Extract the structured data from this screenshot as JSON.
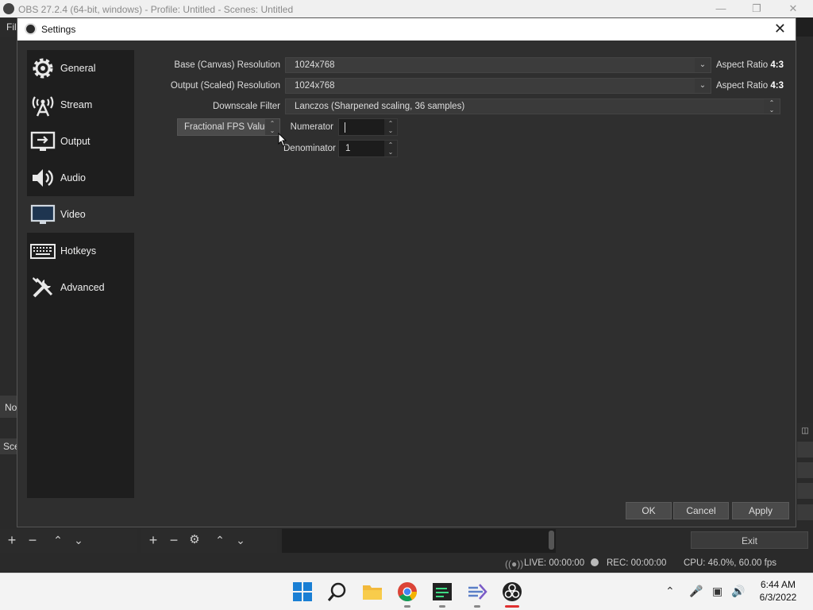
{
  "obs": {
    "title": "OBS 27.2.4 (64-bit, windows) - Profile: Untitled - Scenes: Untitled",
    "menu_partial": "Fil",
    "side_no": "No",
    "side_sce": "Sce",
    "exit_label": "Exit",
    "status": {
      "live": "LIVE: 00:00:00",
      "rec": "REC: 00:00:00",
      "cpu": "CPU: 46.0%, 60.00 fps"
    }
  },
  "dialog": {
    "title": "Settings",
    "nav": [
      {
        "label": "General",
        "icon": "gear-icon"
      },
      {
        "label": "Stream",
        "icon": "antenna-icon"
      },
      {
        "label": "Output",
        "icon": "output-monitor-icon"
      },
      {
        "label": "Audio",
        "icon": "speaker-icon"
      },
      {
        "label": "Video",
        "icon": "monitor-icon",
        "active": true
      },
      {
        "label": "Hotkeys",
        "icon": "keyboard-icon"
      },
      {
        "label": "Advanced",
        "icon": "tools-icon"
      }
    ],
    "video": {
      "base_label": "Base (Canvas) Resolution",
      "base_value": "1024x768",
      "base_aspect_label": "Aspect Ratio",
      "base_aspect_value": "4:3",
      "output_label": "Output (Scaled) Resolution",
      "output_value": "1024x768",
      "output_aspect_label": "Aspect Ratio",
      "output_aspect_value": "4:3",
      "downscale_label": "Downscale Filter",
      "downscale_value": "Lanczos (Sharpened scaling, 36 samples)",
      "fps_type_value": "Fractional FPS Value",
      "numerator_label": "Numerator",
      "numerator_value": "",
      "denominator_label": "Denominator",
      "denominator_value": "1"
    },
    "buttons": {
      "ok": "OK",
      "cancel": "Cancel",
      "apply": "Apply"
    }
  },
  "taskbar": {
    "time": "6:44 AM",
    "date": "6/3/2022"
  }
}
